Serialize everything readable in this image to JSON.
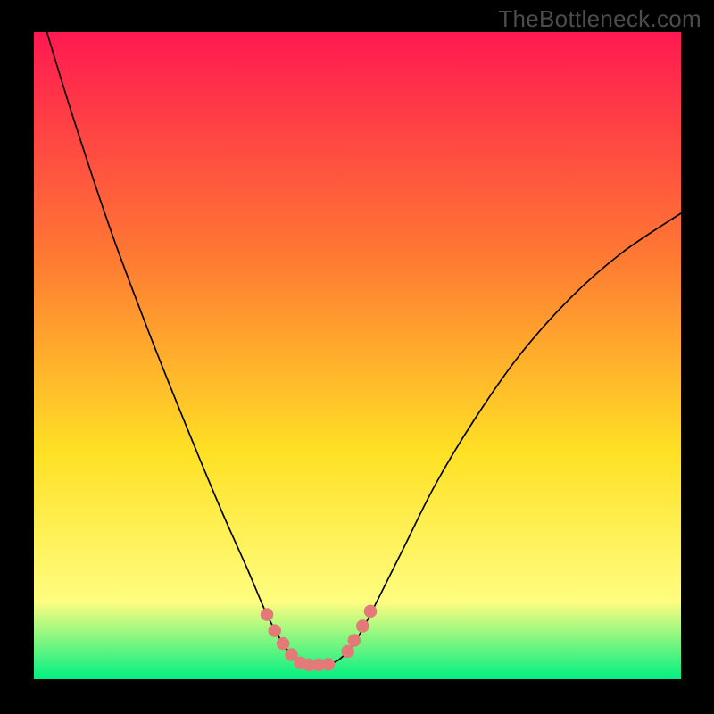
{
  "watermark": {
    "text": "TheBottleneck.com"
  },
  "colors": {
    "frame_bg": "#000000",
    "watermark": "#4c4c4c",
    "gradient_top": "#ff1951",
    "gradient_mid1": "#ff7a33",
    "gradient_mid2": "#ffe125",
    "gradient_mid3": "#fffd80",
    "gradient_bottom": "#00ef82",
    "curve": "#000000",
    "marker_fill": "#e47a77",
    "marker_stroke": "#d46060"
  },
  "chart_data": {
    "type": "line",
    "title": "",
    "xlabel": "",
    "ylabel": "",
    "xlim": [
      0,
      1000
    ],
    "ylim": [
      0,
      1000
    ],
    "note": "Axes unlabeled; values are plot-space coordinates, x increases right, y increases up.",
    "series": [
      {
        "name": "curve",
        "values": [
          {
            "x": 20,
            "y": 1000
          },
          {
            "x": 60,
            "y": 870
          },
          {
            "x": 120,
            "y": 690
          },
          {
            "x": 180,
            "y": 530
          },
          {
            "x": 240,
            "y": 380
          },
          {
            "x": 290,
            "y": 260
          },
          {
            "x": 330,
            "y": 170
          },
          {
            "x": 360,
            "y": 100
          },
          {
            "x": 385,
            "y": 55
          },
          {
            "x": 405,
            "y": 30
          },
          {
            "x": 425,
            "y": 22
          },
          {
            "x": 450,
            "y": 22
          },
          {
            "x": 468,
            "y": 28
          },
          {
            "x": 485,
            "y": 43
          },
          {
            "x": 505,
            "y": 72
          },
          {
            "x": 530,
            "y": 120
          },
          {
            "x": 570,
            "y": 200
          },
          {
            "x": 620,
            "y": 300
          },
          {
            "x": 680,
            "y": 400
          },
          {
            "x": 750,
            "y": 500
          },
          {
            "x": 830,
            "y": 590
          },
          {
            "x": 910,
            "y": 660
          },
          {
            "x": 1000,
            "y": 720
          }
        ]
      }
    ],
    "markers": [
      {
        "x": 360,
        "y": 100
      },
      {
        "x": 372,
        "y": 75
      },
      {
        "x": 385,
        "y": 55
      },
      {
        "x": 398,
        "y": 38
      },
      {
        "x": 412,
        "y": 25
      },
      {
        "x": 425,
        "y": 22
      },
      {
        "x": 440,
        "y": 22
      },
      {
        "x": 455,
        "y": 23
      },
      {
        "x": 485,
        "y": 43
      },
      {
        "x": 495,
        "y": 60
      },
      {
        "x": 508,
        "y": 82
      },
      {
        "x": 520,
        "y": 105
      }
    ]
  }
}
